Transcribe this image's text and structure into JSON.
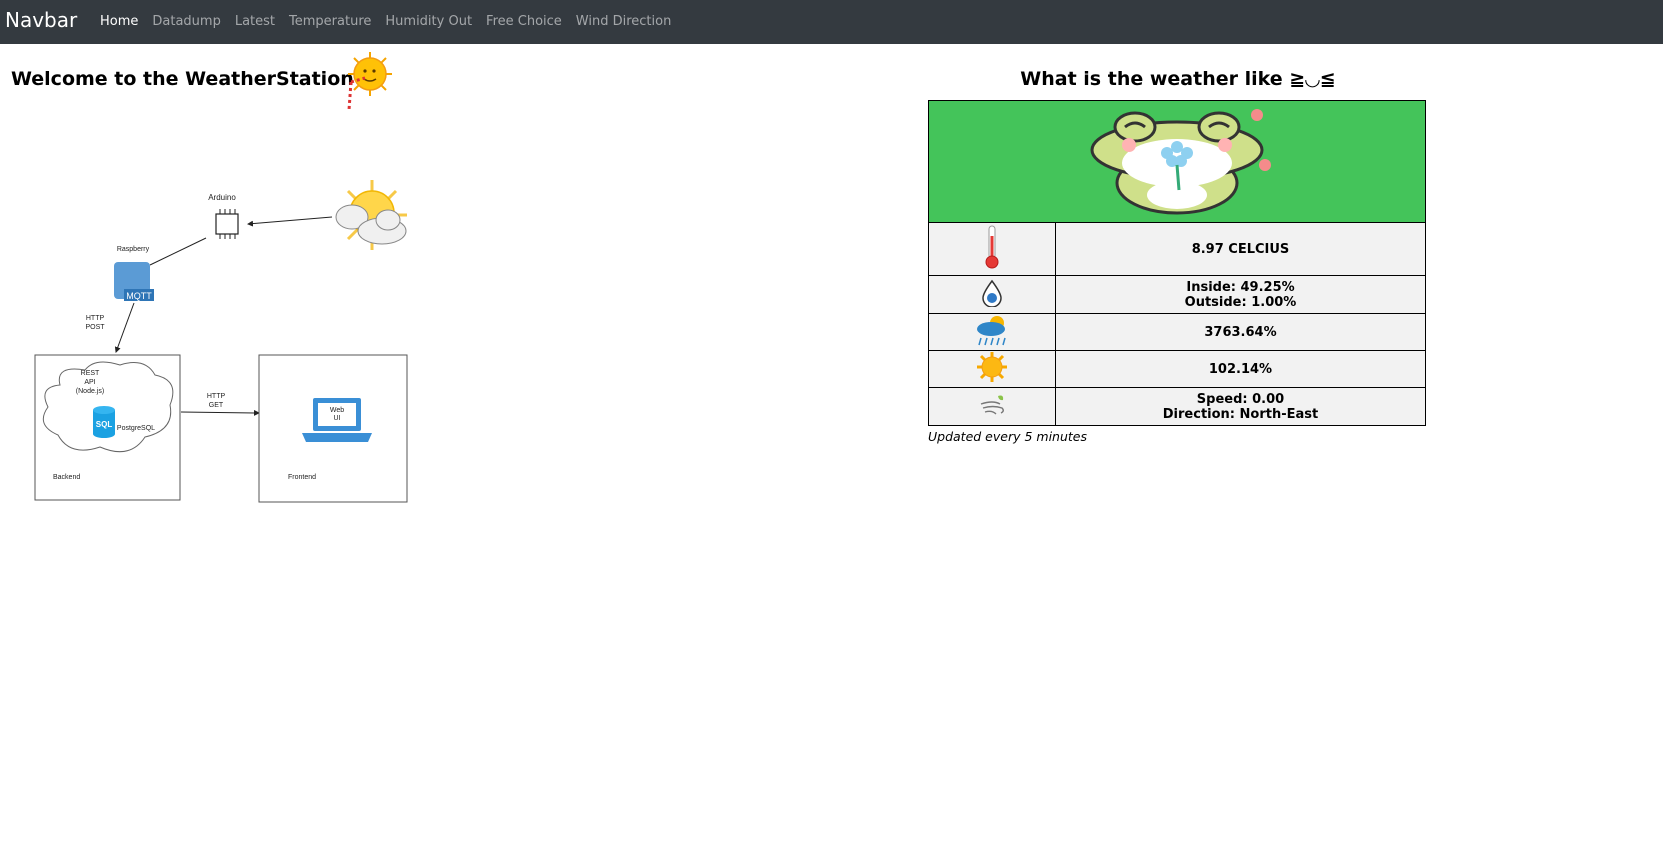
{
  "navbar": {
    "brand": "Navbar",
    "links": [
      {
        "label": "Home",
        "active": true
      },
      {
        "label": "Datadump",
        "active": false
      },
      {
        "label": "Latest",
        "active": false
      },
      {
        "label": "Temperature",
        "active": false
      },
      {
        "label": "Humidity Out",
        "active": false
      },
      {
        "label": "Free Choice",
        "active": false
      },
      {
        "label": "Wind Direction",
        "active": false
      }
    ]
  },
  "left": {
    "title": "Welcome to the WeatherStation",
    "diagram": {
      "arduino": "Arduino",
      "raspberry": "Raspberry",
      "mqtt": "MQTT",
      "http_post_1": "HTTP",
      "http_post_2": "POST",
      "rest_1": "REST",
      "rest_2": "API",
      "rest_3": "(Node.js)",
      "sql": "SQL",
      "postgres": "PostgreSQL",
      "backend": "Backend",
      "http_get_1": "HTTP",
      "http_get_2": "GET",
      "webui_1": "Web",
      "webui_2": "UI",
      "frontend": "Frontend"
    }
  },
  "right": {
    "title": "What is the weather like ≧◡≦",
    "temperature": "8.97 CELCIUS",
    "humidity_inside": "Inside: 49.25%",
    "humidity_outside": "Outside: 1.00%",
    "rain": "3763.64%",
    "sun": "102.14%",
    "wind_speed": "Speed: 0.00",
    "wind_direction": "Direction: North-East",
    "updated": "Updated every 5 minutes"
  },
  "colors": {
    "navbar_bg": "#343a40",
    "hero_bg": "#44c45a"
  }
}
